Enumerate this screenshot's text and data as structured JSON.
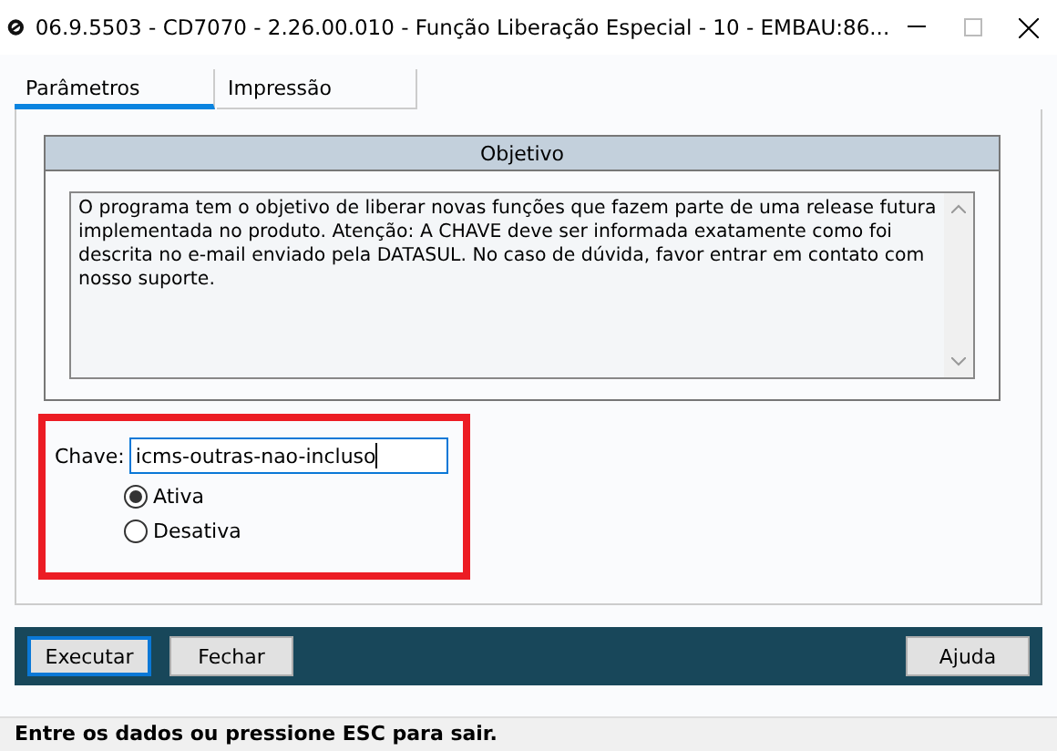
{
  "window": {
    "title": "06.9.5503 - CD7070 - 2.26.00.010 - Função Liberação Especial - 10 - EMBAU:86..."
  },
  "tabs": [
    {
      "label": "Parâmetros",
      "selected": true
    },
    {
      "label": "Impressão",
      "selected": false
    }
  ],
  "objective": {
    "title": "Objetivo",
    "text": "O programa tem o objetivo de liberar novas funções que fazem parte de uma release futura implementada no produto. Atenção: A CHAVE deve ser informada exatamente como foi descrita no e-mail enviado pela DATASUL. No caso de dúvida, favor entrar em contato com nosso suporte."
  },
  "key_field": {
    "label": "Chave:",
    "value": "icms-outras-nao-incluso"
  },
  "options": [
    {
      "label": "Ativa",
      "selected": true
    },
    {
      "label": "Desativa",
      "selected": false
    }
  ],
  "buttons": [
    {
      "label": "Executar",
      "focused": true
    },
    {
      "label": "Fechar",
      "focused": false
    },
    {
      "label": "Ajuda",
      "focused": false
    }
  ],
  "status_bar": "Entre os dados ou pressione ESC para sair."
}
